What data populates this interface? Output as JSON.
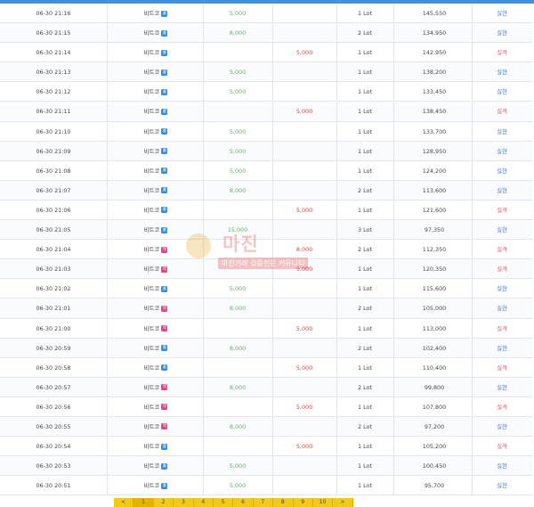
{
  "table": {
    "rows": [
      {
        "time": "06-30 21:16",
        "name": "비트코",
        "badge": "홀",
        "badge_color": "#2f8fe8",
        "up": "5,000",
        "down": "",
        "lot": "1 Lot",
        "price": "145,550",
        "result": "실현",
        "result_type": "win"
      },
      {
        "time": "06-30 21:15",
        "name": "비트코",
        "badge": "홀",
        "badge_color": "#2f8fe8",
        "up": "8,000",
        "down": "",
        "lot": "2 Lot",
        "price": "134,950",
        "result": "실현",
        "result_type": "win"
      },
      {
        "time": "06-30 21:14",
        "name": "비트코",
        "badge": "홀",
        "badge_color": "#2f8fe8",
        "up": "",
        "down": "5,000",
        "lot": "1 Lot",
        "price": "142,950",
        "result": "실격",
        "result_type": "lose"
      },
      {
        "time": "06-30 21:13",
        "name": "비트코",
        "badge": "홀",
        "badge_color": "#2f8fe8",
        "up": "5,000",
        "down": "",
        "lot": "1 Lot",
        "price": "138,200",
        "result": "실현",
        "result_type": "win"
      },
      {
        "time": "06-30 21:12",
        "name": "비트코",
        "badge": "홀",
        "badge_color": "#2f8fe8",
        "up": "5,000",
        "down": "",
        "lot": "1 Lot",
        "price": "133,450",
        "result": "실현",
        "result_type": "win"
      },
      {
        "time": "06-30 21:11",
        "name": "비트코",
        "badge": "홀",
        "badge_color": "#2f8fe8",
        "up": "",
        "down": "5,000",
        "lot": "1 Lot",
        "price": "138,450",
        "result": "실격",
        "result_type": "lose"
      },
      {
        "time": "06-30 21:10",
        "name": "비트코",
        "badge": "홀",
        "badge_color": "#2f8fe8",
        "up": "5,000",
        "down": "",
        "lot": "1 Lot",
        "price": "133,700",
        "result": "실현",
        "result_type": "win"
      },
      {
        "time": "06-30 21:09",
        "name": "비트코",
        "badge": "홀",
        "badge_color": "#2f8fe8",
        "up": "5,000",
        "down": "",
        "lot": "1 Lot",
        "price": "128,950",
        "result": "실현",
        "result_type": "win"
      },
      {
        "time": "06-30 21:08",
        "name": "비트코",
        "badge": "홀",
        "badge_color": "#2f8fe8",
        "up": "5,000",
        "down": "",
        "lot": "1 Lot",
        "price": "124,200",
        "result": "실현",
        "result_type": "win"
      },
      {
        "time": "06-30 21:07",
        "name": "비트코",
        "badge": "홀",
        "badge_color": "#2f8fe8",
        "up": "8,000",
        "down": "",
        "lot": "2 Lot",
        "price": "113,600",
        "result": "실현",
        "result_type": "win"
      },
      {
        "time": "06-30 21:06",
        "name": "비트코",
        "badge": "홀",
        "badge_color": "#2f8fe8",
        "up": "",
        "down": "5,000",
        "lot": "1 Lot",
        "price": "121,600",
        "result": "실격",
        "result_type": "lose"
      },
      {
        "time": "06-30 21:05",
        "name": "비트코",
        "badge": "홀",
        "badge_color": "#2f8fe8",
        "up": "15,000",
        "down": "",
        "lot": "3 Lot",
        "price": "97,350",
        "result": "실현",
        "result_type": "win"
      },
      {
        "time": "06-30 21:04",
        "name": "비트코",
        "badge": "짝",
        "badge_color": "#ec3f8c",
        "up": "",
        "down": "8,000",
        "lot": "2 Lot",
        "price": "112,350",
        "result": "실격",
        "result_type": "lose"
      },
      {
        "time": "06-30 21:03",
        "name": "비트코",
        "badge": "짝",
        "badge_color": "#ec3f8c",
        "up": "",
        "down": "5,000",
        "lot": "1 Lot",
        "price": "120,350",
        "result": "실격",
        "result_type": "lose"
      },
      {
        "time": "06-30 21:02",
        "name": "비트코",
        "badge": "홀",
        "badge_color": "#2f8fe8",
        "up": "5,000",
        "down": "",
        "lot": "1 Lot",
        "price": "115,600",
        "result": "실현",
        "result_type": "win"
      },
      {
        "time": "06-30 21:01",
        "name": "비트코",
        "badge": "짝",
        "badge_color": "#ec3f8c",
        "up": "8,000",
        "down": "",
        "lot": "2 Lot",
        "price": "105,000",
        "result": "실현",
        "result_type": "win"
      },
      {
        "time": "06-30 21:00",
        "name": "비트코",
        "badge": "짝",
        "badge_color": "#ec3f8c",
        "up": "",
        "down": "5,000",
        "lot": "1 Lot",
        "price": "113,000",
        "result": "실격",
        "result_type": "lose"
      },
      {
        "time": "06-30 20:59",
        "name": "비트코",
        "badge": "홀",
        "badge_color": "#2f8fe8",
        "up": "8,000",
        "down": "",
        "lot": "2 Lot",
        "price": "102,400",
        "result": "실현",
        "result_type": "win"
      },
      {
        "time": "06-30 20:58",
        "name": "비트코",
        "badge": "홀",
        "badge_color": "#2f8fe8",
        "up": "",
        "down": "5,000",
        "lot": "1 Lot",
        "price": "110,400",
        "result": "실격",
        "result_type": "lose"
      },
      {
        "time": "06-30 20:57",
        "name": "비트코",
        "badge": "짝",
        "badge_color": "#ec3f8c",
        "up": "8,000",
        "down": "",
        "lot": "2 Lot",
        "price": "99,800",
        "result": "실현",
        "result_type": "win"
      },
      {
        "time": "06-30 20:56",
        "name": "비트코",
        "badge": "짝",
        "badge_color": "#ec3f8c",
        "up": "",
        "down": "5,000",
        "lot": "1 Lot",
        "price": "107,800",
        "result": "실격",
        "result_type": "lose"
      },
      {
        "time": "06-30 20:55",
        "name": "비트코",
        "badge": "짝",
        "badge_color": "#ec3f8c",
        "up": "8,000",
        "down": "",
        "lot": "2 Lot",
        "price": "97,200",
        "result": "실현",
        "result_type": "win"
      },
      {
        "time": "06-30 20:54",
        "name": "비트코",
        "badge": "홀",
        "badge_color": "#2f8fe8",
        "up": "",
        "down": "5,000",
        "lot": "1 Lot",
        "price": "105,200",
        "result": "실격",
        "result_type": "lose"
      },
      {
        "time": "06-30 20:53",
        "name": "비트코",
        "badge": "홀",
        "badge_color": "#2f8fe8",
        "up": "5,000",
        "down": "",
        "lot": "1 Lot",
        "price": "100,450",
        "result": "실현",
        "result_type": "win"
      },
      {
        "time": "06-30 20:51",
        "name": "비트코",
        "badge": "홀",
        "badge_color": "#2f8fe8",
        "up": "5,000",
        "down": "",
        "lot": "1 Lot",
        "price": "95,700",
        "result": "실현",
        "result_type": "win"
      }
    ]
  },
  "pagination": {
    "prev_label": "<",
    "pages": [
      "1",
      "2",
      "3",
      "4",
      "5",
      "6",
      "7",
      "8",
      "9",
      "10"
    ],
    "current": "1",
    "next_label": ">"
  },
  "watermark": {
    "title": "마진",
    "subtitle": "마진거래 검증전문 커뮤니티"
  },
  "colors": {
    "up": "#5fae6e",
    "down": "#d44545",
    "win": "#4a78c7",
    "lose": "#e0576b",
    "pagination": "#f3c81c"
  }
}
